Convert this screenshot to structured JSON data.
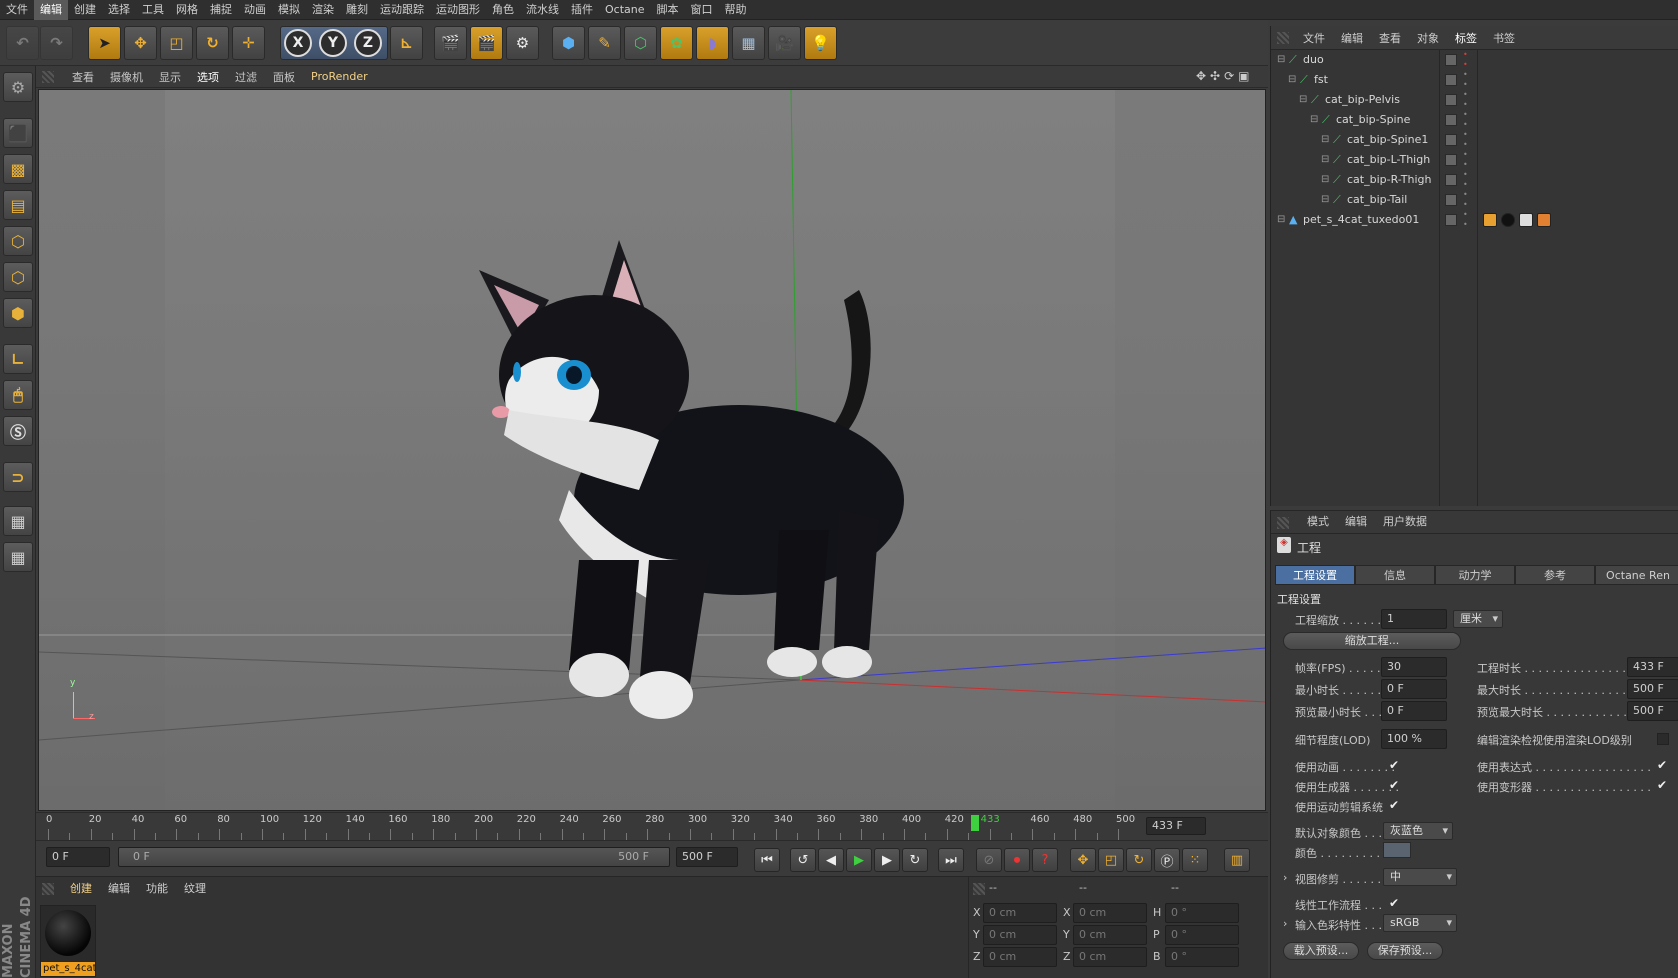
{
  "menubar": [
    "文件",
    "编辑",
    "创建",
    "选择",
    "工具",
    "网格",
    "捕捉",
    "动画",
    "模拟",
    "渲染",
    "雕刻",
    "运动跟踪",
    "运动图形",
    "角色",
    "流水线",
    "插件",
    "Octane",
    "脚本",
    "窗口",
    "帮助"
  ],
  "menubar_active": "编辑",
  "toolbar": {
    "x": "X",
    "y": "Y",
    "z": "Z"
  },
  "viewport_menu": [
    "查看",
    "摄像机",
    "显示",
    "选项",
    "过滤",
    "面板",
    "ProRender"
  ],
  "viewport_menu_selected": "选项",
  "viewport_axis": {
    "y": "y",
    "z": "z"
  },
  "timeline": {
    "ticks": [
      "0",
      "20",
      "40",
      "60",
      "80",
      "100",
      "120",
      "140",
      "160",
      "180",
      "200",
      "220",
      "240",
      "260",
      "280",
      "300",
      "320",
      "340",
      "360",
      "380",
      "400",
      "420",
      "433",
      "460",
      "480",
      "500"
    ],
    "current_frame": "433",
    "end_field": "433 F"
  },
  "transport": {
    "start": "0 F",
    "range_start": "0 F",
    "range_end": "500 F",
    "end": "500 F"
  },
  "material_panel": {
    "menu": [
      "创建",
      "编辑",
      "功能",
      "纹理"
    ],
    "material_name": "pet_s_4cat"
  },
  "coord_panel": {
    "headers": [
      "--",
      "--",
      "--"
    ],
    "rows": [
      {
        "axis": "X",
        "pos": "0 cm",
        "axis2": "X",
        "size": "0 cm",
        "rot_axis": "H",
        "rot": "0 °"
      },
      {
        "axis": "Y",
        "pos": "0 cm",
        "axis2": "Y",
        "size": "0 cm",
        "rot_axis": "P",
        "rot": "0 °"
      },
      {
        "axis": "Z",
        "pos": "0 cm",
        "axis2": "Z",
        "size": "0 cm",
        "rot_axis": "B",
        "rot": "0 °"
      }
    ]
  },
  "object_manager": {
    "menu": [
      "文件",
      "编辑",
      "查看",
      "对象",
      "标签",
      "书签"
    ],
    "menu_active": "标签",
    "objects": [
      {
        "name": "duo",
        "level": 0
      },
      {
        "name": "fst",
        "level": 1
      },
      {
        "name": "cat_bip-Pelvis",
        "level": 2
      },
      {
        "name": "cat_bip-Spine",
        "level": 3
      },
      {
        "name": "cat_bip-Spine1",
        "level": 4
      },
      {
        "name": "cat_bip-L-Thigh",
        "level": 4
      },
      {
        "name": "cat_bip-R-Thigh",
        "level": 4
      },
      {
        "name": "cat_bip-Tail",
        "level": 4
      },
      {
        "name": "pet_s_4cat_tuxedo01",
        "level": 0
      }
    ]
  },
  "attributes": {
    "menu": [
      "模式",
      "编辑",
      "用户数据"
    ],
    "title": "工程",
    "tabs": [
      "工程设置",
      "信息",
      "动力学",
      "参考",
      "Octane Ren"
    ],
    "section": "工程设置",
    "scale_label": "工程缩放",
    "scale_value": "1",
    "scale_unit": "厘米",
    "scale_button": "缩放工程...",
    "fps_label": "帧率(FPS)",
    "fps_value": "30",
    "proj_len_label": "工程时长",
    "proj_len_value": "433 F",
    "min_len_label": "最小时长",
    "min_len_value": "0 F",
    "max_len_label": "最大时长",
    "max_len_value": "500 F",
    "pmin_label": "预览最小时长",
    "pmin_value": "0 F",
    "pmax_label": "预览最大时长",
    "pmax_value": "500 F",
    "lod_label": "细节程度(LOD)",
    "lod_value": "100 %",
    "lod_render_label": "编辑渲染检视使用渲染LOD级别",
    "use_anim": "使用动画",
    "use_expr": "使用表达式",
    "use_gen": "使用生成器",
    "use_deform": "使用变形器",
    "use_motion": "使用运动剪辑系统",
    "default_color_label": "默认对象颜色",
    "default_color_value": "灰蓝色",
    "color_label": "颜色",
    "view_clip_label": "视图修剪",
    "view_clip_value": "中",
    "linear_label": "线性工作流程",
    "input_color_label": "输入色彩特性",
    "input_color_value": "sRGB",
    "load_preset": "载入预设...",
    "save_preset": "保存预设..."
  },
  "brand": "MAXON CINEMA 4D"
}
